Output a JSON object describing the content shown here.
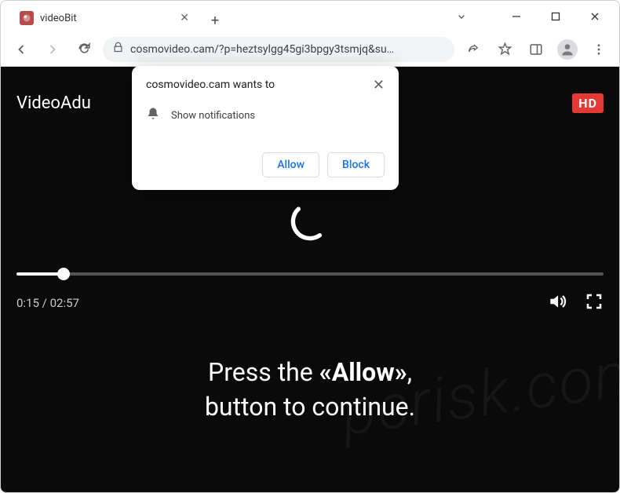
{
  "window": {
    "tab_title": "videoBit"
  },
  "toolbar": {
    "url": "cosmovideo.cam/?p=heztsylgg45gi3bpgy3tsmjq&su…"
  },
  "prompt": {
    "title": "cosmovideo.cam wants to",
    "permission_text": "Show notifications",
    "allow_label": "Allow",
    "block_label": "Block"
  },
  "player": {
    "brand": "VideoAdu",
    "hd_label": "HD",
    "current_time": "0:15",
    "duration": "02:57",
    "time_separator": " / "
  },
  "cta": {
    "prefix": "Press the ",
    "emphasis": "«Allow»",
    "suffix": ",",
    "line2": "button to continue."
  },
  "watermark": "pcrisk.com"
}
